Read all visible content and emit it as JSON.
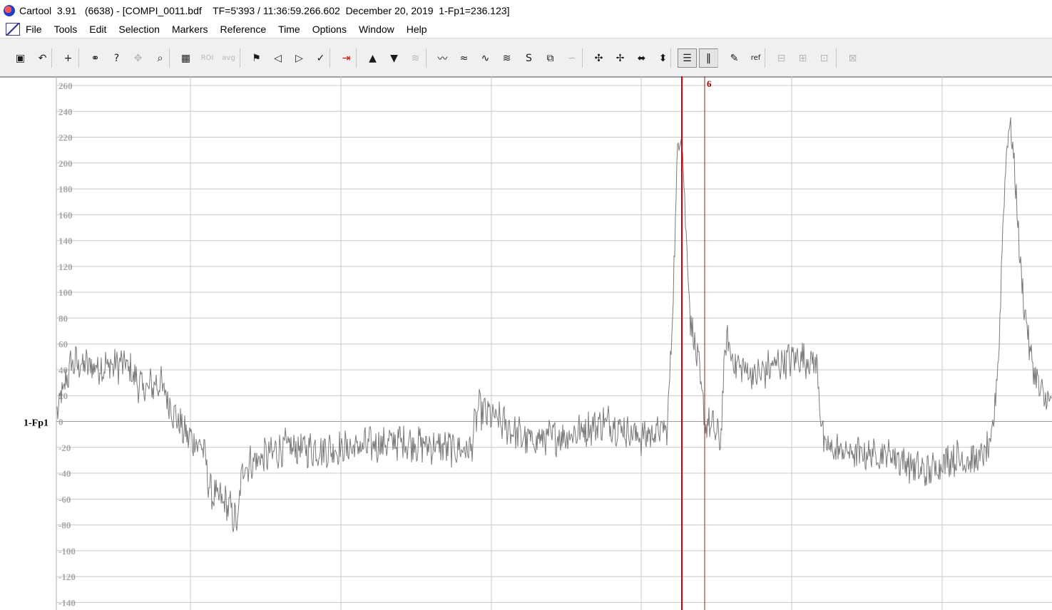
{
  "window": {
    "title": "Cartool  3.91   (6638) - [COMPI_0011.bdf    TF=5'393 / 11:36:59.266.602  December 20, 2019  1-Fp1=236.123]"
  },
  "menu": {
    "items": [
      "File",
      "Tools",
      "Edit",
      "Selection",
      "Markers",
      "Reference",
      "Time",
      "Options",
      "Window",
      "Help"
    ]
  },
  "toolbar": {
    "buttons": [
      {
        "name": "save-display-icon",
        "glyph": "▣"
      },
      {
        "name": "undo-icon",
        "glyph": "↶"
      },
      {
        "name": "add-track-icon",
        "glyph": "+"
      },
      {
        "name": "link-icon",
        "glyph": "⚭"
      },
      {
        "name": "zoom-query-icon",
        "glyph": "?"
      },
      {
        "name": "compass-icon",
        "glyph": "✥"
      },
      {
        "name": "magnifier-icon",
        "glyph": "⌕"
      },
      {
        "name": "montage-icon",
        "glyph": "▦"
      },
      {
        "name": "roi-icon",
        "glyph": "ROI"
      },
      {
        "name": "average-icon",
        "glyph": "avg"
      },
      {
        "name": "flag-icon",
        "glyph": "⚑"
      },
      {
        "name": "previous-marker-icon",
        "glyph": "◁"
      },
      {
        "name": "next-marker-icon",
        "glyph": "▷"
      },
      {
        "name": "check-marker-icon",
        "glyph": "✓"
      },
      {
        "name": "go-to-marker-icon",
        "glyph": "⇥"
      },
      {
        "name": "scale-up-icon",
        "glyph": "▲"
      },
      {
        "name": "scale-down-icon",
        "glyph": "▼"
      },
      {
        "name": "filter-icon",
        "glyph": "≋"
      },
      {
        "name": "compress-tracks-icon",
        "glyph": "〰"
      },
      {
        "name": "expand-tracks-icon",
        "glyph": "≈"
      },
      {
        "name": "wave-down-icon",
        "glyph": "∿"
      },
      {
        "name": "wave-up-icon",
        "glyph": "≋"
      },
      {
        "name": "s-trace-icon",
        "glyph": "S"
      },
      {
        "name": "time-zoom-icon",
        "glyph": "⧉"
      },
      {
        "name": "spline-icon",
        "glyph": "∽"
      },
      {
        "name": "contrast-up-icon",
        "glyph": "✣"
      },
      {
        "name": "contrast-down-icon",
        "glyph": "✢"
      },
      {
        "name": "spread-icon",
        "glyph": "⬌"
      },
      {
        "name": "merge-icon",
        "glyph": "⬍"
      },
      {
        "name": "horizontal-grid-icon",
        "glyph": "☰"
      },
      {
        "name": "vertical-grid-icon",
        "glyph": "‖"
      },
      {
        "name": "color-picker-icon",
        "glyph": "✎"
      },
      {
        "name": "reference-icon",
        "glyph": "ref"
      },
      {
        "name": "baseline-minus-icon",
        "glyph": "⊟"
      },
      {
        "name": "baseline-plus-icon",
        "glyph": "⊞"
      },
      {
        "name": "layout-1-icon",
        "glyph": "⊡"
      },
      {
        "name": "layout-2-icon",
        "glyph": "⊠"
      }
    ]
  },
  "plot": {
    "channel_label": "1-Fp1",
    "y_ticks": [
      "260",
      "240",
      "220",
      "200",
      "180",
      "160",
      "140",
      "120",
      "100",
      "80",
      "60",
      "40",
      "20",
      "0",
      "-20",
      "-40",
      "-60",
      "-80",
      "-100",
      "-120",
      "-140"
    ],
    "marker_label": "6",
    "colors": {
      "trace": "#7a7a7a",
      "grid": "#c8c8c8",
      "cursor": "#d40000",
      "marker": "#8b2020"
    }
  }
}
